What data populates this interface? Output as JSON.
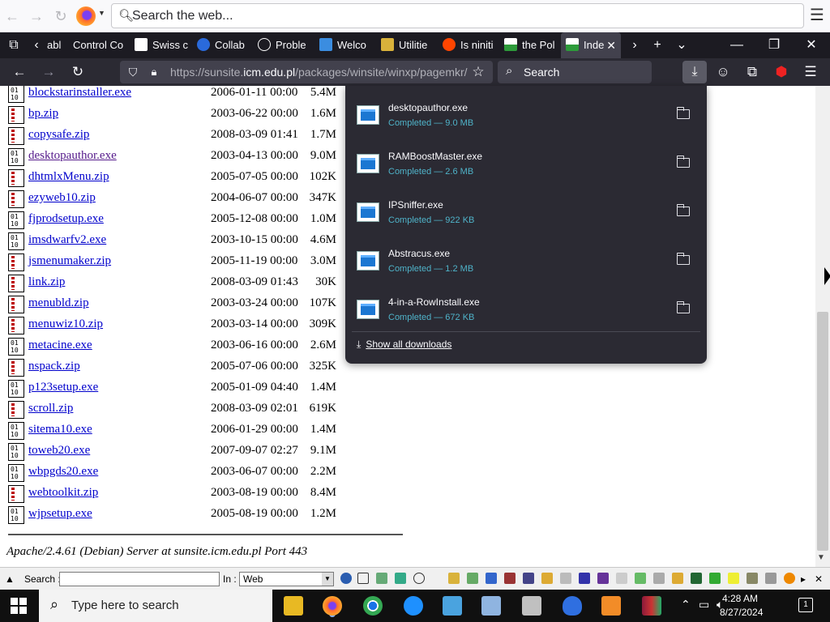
{
  "toolbar": {
    "search_placeholder": "Search the web..."
  },
  "tabs": [
    {
      "label": "abl",
      "icon": "page-icon"
    },
    {
      "label": "Control Co",
      "icon": "page-icon"
    },
    {
      "label": "Swiss c",
      "icon": "page-icon"
    },
    {
      "label": "Collab",
      "icon": "globe-icon"
    },
    {
      "label": "Proble",
      "icon": "info-icon"
    },
    {
      "label": "Welco",
      "icon": "page-icon"
    },
    {
      "label": "Utilitie",
      "icon": "page-icon"
    },
    {
      "label": "Is niniti",
      "icon": "reddit-icon"
    },
    {
      "label": "the Pol",
      "icon": "page-icon"
    },
    {
      "label": "Inde",
      "icon": "page-icon",
      "active": true
    }
  ],
  "navbar": {
    "url_prefix": "https://sunsite.",
    "url_domain": "icm.edu.pl",
    "url_path": "/packages/winsite/winxp/pagemkr/",
    "search_label": "Search"
  },
  "files": [
    {
      "name": "blockstarinstaller.exe",
      "date": "2006-01-11 00:00",
      "size": "5.4M",
      "type": "exe"
    },
    {
      "name": "bp.zip",
      "date": "2003-06-22 00:00",
      "size": "1.6M",
      "type": "zip"
    },
    {
      "name": "copysafe.zip",
      "date": "2008-03-09 01:41",
      "size": "1.7M",
      "type": "zip"
    },
    {
      "name": "desktopauthor.exe",
      "date": "2003-04-13 00:00",
      "size": "9.0M",
      "type": "exe",
      "visited": true
    },
    {
      "name": "dhtmlxMenu.zip",
      "date": "2005-07-05 00:00",
      "size": "102K",
      "type": "zip"
    },
    {
      "name": "ezyweb10.zip",
      "date": "2004-06-07 00:00",
      "size": "347K",
      "type": "zip"
    },
    {
      "name": "fjprodsetup.exe",
      "date": "2005-12-08 00:00",
      "size": "1.0M",
      "type": "exe"
    },
    {
      "name": "imsdwarfv2.exe",
      "date": "2003-10-15 00:00",
      "size": "4.6M",
      "type": "exe"
    },
    {
      "name": "jsmenumaker.zip",
      "date": "2005-11-19 00:00",
      "size": "3.0M",
      "type": "zip"
    },
    {
      "name": "link.zip",
      "date": "2008-03-09 01:43",
      "size": "30K",
      "type": "zip"
    },
    {
      "name": "menubld.zip",
      "date": "2003-03-24 00:00",
      "size": "107K",
      "type": "zip"
    },
    {
      "name": "menuwiz10.zip",
      "date": "2003-03-14 00:00",
      "size": "309K",
      "type": "zip"
    },
    {
      "name": "metacine.exe",
      "date": "2003-06-16 00:00",
      "size": "2.6M",
      "type": "exe"
    },
    {
      "name": "nspack.zip",
      "date": "2005-07-06 00:00",
      "size": "325K",
      "type": "zip"
    },
    {
      "name": "p123setup.exe",
      "date": "2005-01-09 04:40",
      "size": "1.4M",
      "type": "exe"
    },
    {
      "name": "scroll.zip",
      "date": "2008-03-09 02:01",
      "size": "619K",
      "type": "zip"
    },
    {
      "name": "sitema10.exe",
      "date": "2006-01-29 00:00",
      "size": "1.4M",
      "type": "exe"
    },
    {
      "name": "toweb20.exe",
      "date": "2007-09-07 02:27",
      "size": "9.1M",
      "type": "exe"
    },
    {
      "name": "wbpgds20.exe",
      "date": "2003-06-07 00:00",
      "size": "2.2M",
      "type": "exe"
    },
    {
      "name": "webtoolkit.zip",
      "date": "2003-08-19 00:00",
      "size": "8.4M",
      "type": "zip"
    },
    {
      "name": "wjpsetup.exe",
      "date": "2005-08-19 00:00",
      "size": "1.2M",
      "type": "exe"
    }
  ],
  "footer": {
    "server": "Apache/2.4.61 (Debian) Server at sunsite.icm.edu.pl Port 443"
  },
  "downloads": {
    "items": [
      {
        "name": "desktopauthor.exe",
        "status": "Completed — 9.0 MB"
      },
      {
        "name": "RAMBoostMaster.exe",
        "status": "Completed — 2.6 MB"
      },
      {
        "name": "IPSniffer.exe",
        "status": "Completed — 922 KB"
      },
      {
        "name": "Abstracus.exe",
        "status": "Completed — 1.2 MB"
      },
      {
        "name": "4-in-a-RowInstall.exe",
        "status": "Completed — 672 KB"
      }
    ],
    "show_all": "Show all downloads"
  },
  "findbar": {
    "search_label": "Search :",
    "in_label": "In :",
    "in_value": "Web"
  },
  "taskbar": {
    "search_placeholder": "Type here to search",
    "time": "4:28 AM",
    "date": "8/27/2024",
    "notifications": "1"
  },
  "colors": {
    "link": "#0000cc",
    "visited": "#551a8b",
    "panel_bg": "#2b2a33",
    "status_text": "#4fb3c9"
  }
}
